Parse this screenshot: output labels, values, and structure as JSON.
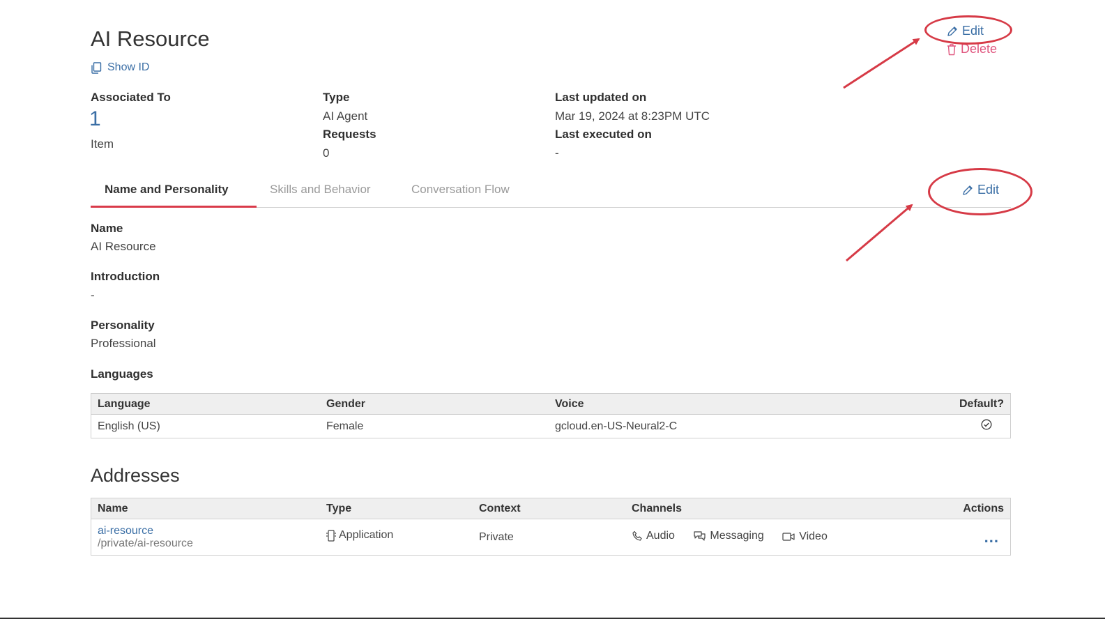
{
  "header": {
    "title": "AI Resource",
    "show_id_label": "Show ID",
    "edit_label": "Edit",
    "delete_label": "Delete"
  },
  "summary": {
    "associated_to_label": "Associated To",
    "associated_to_count": "1",
    "associated_to_unit": "Item",
    "type_label": "Type",
    "type_value": "AI Agent",
    "requests_label": "Requests",
    "requests_value": "0",
    "last_updated_label": "Last updated on",
    "last_updated_value": "Mar 19, 2024 at 8:23PM UTC",
    "last_executed_label": "Last executed on",
    "last_executed_value": "-"
  },
  "tabs": [
    {
      "label": "Name and Personality",
      "active": true
    },
    {
      "label": "Skills and Behavior",
      "active": false
    },
    {
      "label": "Conversation Flow",
      "active": false
    }
  ],
  "tab_edit_label": "Edit",
  "details": {
    "name_label": "Name",
    "name_value": "AI Resource",
    "introduction_label": "Introduction",
    "introduction_value": "-",
    "personality_label": "Personality",
    "personality_value": "Professional",
    "languages_label": "Languages"
  },
  "languages_table": {
    "headers": [
      "Language",
      "Gender",
      "Voice",
      "Default?"
    ],
    "rows": [
      {
        "language": "English (US)",
        "gender": "Female",
        "voice": "gcloud.en-US-Neural2-C",
        "default": true
      }
    ]
  },
  "addresses": {
    "title": "Addresses",
    "headers": [
      "Name",
      "Type",
      "Context",
      "Channels",
      "Actions"
    ],
    "rows": [
      {
        "name": "ai-resource",
        "path": "/private/ai-resource",
        "type": "Application",
        "context": "Private",
        "channels": [
          "Audio",
          "Messaging",
          "Video"
        ],
        "actions": "..."
      }
    ]
  },
  "colors": {
    "accent_link": "#3a6ea5",
    "delete": "#e0557e",
    "tab_active_underline": "#d93a4a",
    "annotation": "#d63a46"
  },
  "icons": [
    "copy-icon",
    "pencil-icon",
    "trash-icon",
    "check-circle-icon",
    "mobile-icon",
    "phone-icon",
    "chat-icon",
    "video-icon",
    "ellipsis-icon"
  ]
}
